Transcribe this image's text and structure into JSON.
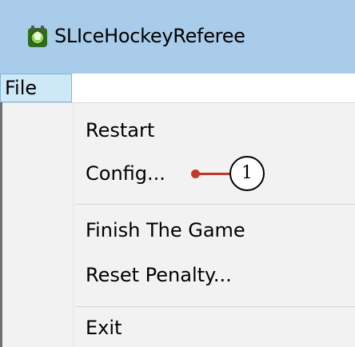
{
  "window": {
    "title": "SLIceHockeyReferee",
    "icon": "hockey-app-icon"
  },
  "menubar": {
    "file_label": "File"
  },
  "file_menu": {
    "items": [
      {
        "label": "Restart"
      },
      {
        "label": "Config..."
      },
      {
        "label": "Finish The Game"
      },
      {
        "label": "Reset Penalty..."
      },
      {
        "label": "Exit"
      }
    ]
  },
  "callout": {
    "number": "1",
    "color": "#c0392b"
  },
  "colors": {
    "titlebar": "#a9ccea",
    "menu_active": "#cde8f7",
    "menu_background": "#f2f2f2"
  }
}
